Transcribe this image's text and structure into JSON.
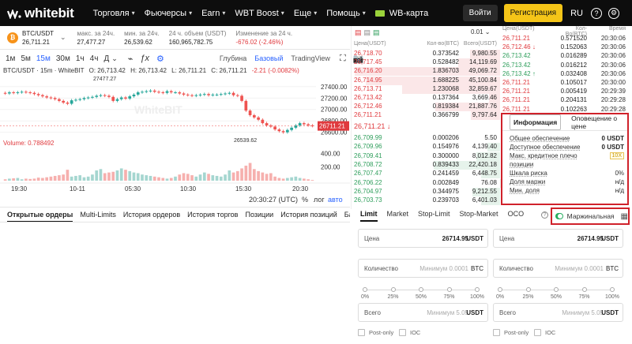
{
  "nav": {
    "logo": "whitebit",
    "items": [
      {
        "label": "Торговля",
        "caret": true
      },
      {
        "label": "Фьючерсы",
        "caret": true
      },
      {
        "label": "Earn",
        "caret": true
      },
      {
        "label": "WBT Boost",
        "caret": true
      },
      {
        "label": "Еще",
        "caret": true
      },
      {
        "label": "Помощь",
        "caret": true
      },
      {
        "label": "WB-карта",
        "caret": false
      }
    ],
    "login": "Войти",
    "register": "Регистрация",
    "lang": "RU"
  },
  "ticker": {
    "pair": "BTC/USDT",
    "price": "26,711.21",
    "stats": [
      {
        "label": "макс. за 24ч.",
        "value": "27,477.27"
      },
      {
        "label": "мин. за 24ч.",
        "value": "26,539.62"
      },
      {
        "label": "24 ч. объем (USDT)",
        "value": "160,965,782.75"
      },
      {
        "label": "Изменение за 24 ч.",
        "value": "-676.02 (-2.46%)"
      }
    ],
    "down_color": "#e03a3e"
  },
  "chart_toolbar": {
    "timeframes": [
      "1м",
      "5м",
      "15м",
      "30м",
      "1ч",
      "4ч",
      "Д"
    ],
    "active_timeframe": "15м",
    "views": [
      "Глубина",
      "Базовый",
      "TradingView"
    ],
    "active_view": "Базовый"
  },
  "chart": {
    "symbol": "BTC/USDT · 15m · WhiteBIT",
    "ohlc": {
      "o": "O: 26,713.42",
      "h": "H: 26,713.42",
      "l": "L: 26,711.21",
      "c": "C: 26,711.21",
      "chg": "-2.21 (-0.0082%)"
    },
    "high_label": "27477.27",
    "low_label": "26539.62",
    "last_price": "26711.21",
    "watermark": "WhiteBIT",
    "volume_label": "Volume: 0.788492",
    "time_readout": "20:30:27 (UTC)",
    "scale_buttons": [
      "%",
      "лог",
      "авто"
    ]
  },
  "chart_data": {
    "type": "candlestick",
    "x_ticks": [
      "19:30",
      "10-11",
      "05:30",
      "10:30",
      "15:30",
      "20:30"
    ],
    "price_ticks": [
      27400,
      27200,
      27000,
      26800,
      26600
    ],
    "ylim": [
      26540,
      27480
    ],
    "volume_ticks": [
      400,
      200
    ],
    "volume_ylim": [
      0,
      520
    ],
    "closes": [
      27280,
      27300,
      27290,
      27300,
      27310,
      27300,
      27290,
      27270,
      27250,
      27230,
      27210,
      27200,
      27180,
      27150,
      27120,
      27100,
      27160,
      27170,
      27180,
      27200,
      27210,
      27220,
      27240,
      27250,
      27240,
      27220,
      27150,
      27180,
      27210,
      27190,
      27230,
      27260,
      27300,
      27310,
      27320,
      27330,
      27310,
      27300,
      27290,
      27320,
      27300,
      27300,
      27280,
      27260,
      27250,
      27240,
      27250,
      27260,
      27270,
      27250,
      27260,
      27260,
      27270,
      27280,
      27290,
      27250,
      27240,
      27150,
      26980,
      26900,
      26860,
      26820,
      26760,
      26720,
      26700,
      26650,
      26620,
      26600,
      26640,
      26680,
      26720,
      26760,
      26740,
      26720,
      26711
    ],
    "volumes": [
      20,
      30,
      35,
      40,
      20,
      30,
      25,
      30,
      45,
      40,
      50,
      60,
      70,
      80,
      90,
      160,
      60,
      70,
      80,
      50,
      60,
      90,
      150,
      170,
      110,
      120,
      130,
      150,
      180,
      160,
      140,
      120,
      110,
      90,
      80,
      70,
      60,
      50,
      40,
      30,
      40,
      60,
      90,
      110,
      100,
      80,
      60,
      90,
      120,
      100,
      80,
      70,
      60,
      90,
      150,
      120,
      140,
      180,
      220,
      260,
      170,
      140,
      120,
      100,
      110,
      60,
      40,
      30,
      40,
      50,
      60,
      40,
      30,
      20,
      10
    ]
  },
  "bottom_tabs": [
    "Открытые ордеры",
    "Multi-Limits",
    "История ордеров",
    "История торгов",
    "Позиции",
    "История позиций",
    "Балансы",
    "Займ"
  ],
  "orderbook": {
    "precision": "0.01",
    "headers": [
      "Цена(USDT)",
      "Кол-во(BTC)",
      "Всего(USDT)"
    ],
    "asks": [
      {
        "price": "26,718.70",
        "qty": "0.373542",
        "total": "9,980.55"
      },
      {
        "price": "26,717.45",
        "qty": "0.528482",
        "total": "14,119.69"
      },
      {
        "price": "26,716.20",
        "qty": "1.836703",
        "total": "49,069.72"
      },
      {
        "price": "26,714.95",
        "qty": "1.688225",
        "total": "45,100.84"
      },
      {
        "price": "26,713.71",
        "qty": "1.230068",
        "total": "32,859.67"
      },
      {
        "price": "26,713.42",
        "qty": "0.137364",
        "total": "3,669.46"
      },
      {
        "price": "26,712.46",
        "qty": "0.819384",
        "total": "21,887.76"
      },
      {
        "price": "26,711.21",
        "qty": "0.366799",
        "total": "9,797.64"
      }
    ],
    "mid_price": "26,711.21 ↓",
    "bids": [
      {
        "price": "26,709.99",
        "qty": "0.000206",
        "total": "5.50"
      },
      {
        "price": "26,709.96",
        "qty": "0.154976",
        "total": "4,139.40"
      },
      {
        "price": "26,709.41",
        "qty": "0.300000",
        "total": "8,012.82"
      },
      {
        "price": "26,708.72",
        "qty": "0.839433",
        "total": "22,420.18"
      },
      {
        "price": "26,707.47",
        "qty": "0.241459",
        "total": "6,448.75"
      },
      {
        "price": "26,706.22",
        "qty": "0.002849",
        "total": "76.08"
      },
      {
        "price": "26,704.97",
        "qty": "0.344975",
        "total": "9,212.55"
      },
      {
        "price": "26,703.73",
        "qty": "0.239703",
        "total": "6,401.03"
      }
    ],
    "ask_color": "#e03a3e",
    "bid_color": "#2e9e5b"
  },
  "trades": {
    "headers": [
      "Цена(USDT)",
      "Кол-Во(BTC)",
      "Время"
    ],
    "rows": [
      {
        "price": "26,711.21",
        "qty": "0.571520",
        "time": "20:30:06",
        "side": "sell"
      },
      {
        "price": "26,712.46 ↓",
        "qty": "0.152063",
        "time": "20:30:06",
        "side": "sell"
      },
      {
        "price": "26,713.42",
        "qty": "0.016289",
        "time": "20:30:06",
        "side": "buy"
      },
      {
        "price": "26,713.42",
        "qty": "0.016212",
        "time": "20:30:06",
        "side": "buy"
      },
      {
        "price": "26,713.42 ↑",
        "qty": "0.032408",
        "time": "20:30:06",
        "side": "buy"
      },
      {
        "price": "26,711.21",
        "qty": "0.105017",
        "time": "20:30:00",
        "side": "sell"
      },
      {
        "price": "26,711.21",
        "qty": "0.005419",
        "time": "20:29:39",
        "side": "sell"
      },
      {
        "price": "26,711.21",
        "qty": "0.204131",
        "time": "20:29:28",
        "side": "sell"
      },
      {
        "price": "26,711.21",
        "qty": "0.102263",
        "time": "20:29:28",
        "side": "sell"
      }
    ]
  },
  "info_panel": {
    "tabs": [
      "Информация",
      "Оповещение о цене"
    ],
    "rows": [
      {
        "label": "Общее обеспечение",
        "value": "0 USDT"
      },
      {
        "label": "Доступное обеспечение",
        "value": "0 USDT"
      },
      {
        "label": "Макс. кредитное плечо",
        "value": "10X"
      },
      {
        "label": "позиции",
        "value": ""
      },
      {
        "label": "Шкала риска",
        "value": "0%"
      },
      {
        "label": "Доля маржи",
        "value": "н/д"
      },
      {
        "label": "Мин. доля",
        "value": "н/д"
      }
    ]
  },
  "order_form": {
    "tabs": [
      "Limit",
      "Market",
      "Stop-Limit",
      "Stop-Market",
      "OCO"
    ],
    "active_tab": "Limit",
    "margin_label": "Маржинальная",
    "margin_enabled": true,
    "buy": {
      "price_label": "Цена",
      "price_value": "26714.95",
      "price_unit": "USDT",
      "qty_label": "Количество",
      "qty_placeholder": "Минимум 0.0001",
      "qty_unit": "BTC",
      "total_label": "Всего",
      "total_placeholder": "Минимум 5.05",
      "total_unit": "USDT",
      "post_only": "Post-only",
      "ioc": "IOC"
    },
    "sell": {
      "price_label": "Цена",
      "price_value": "26714.95",
      "price_unit": "USDT",
      "qty_label": "Количество",
      "qty_placeholder": "Минимум 0.0001",
      "qty_unit": "BTC",
      "total_label": "Всего",
      "total_placeholder": "Минимум 5.05",
      "total_unit": "USDT",
      "post_only": "Post-only",
      "ioc": "IOC"
    },
    "slider_marks": [
      "0%",
      "25%",
      "50%",
      "75%",
      "100%"
    ]
  }
}
